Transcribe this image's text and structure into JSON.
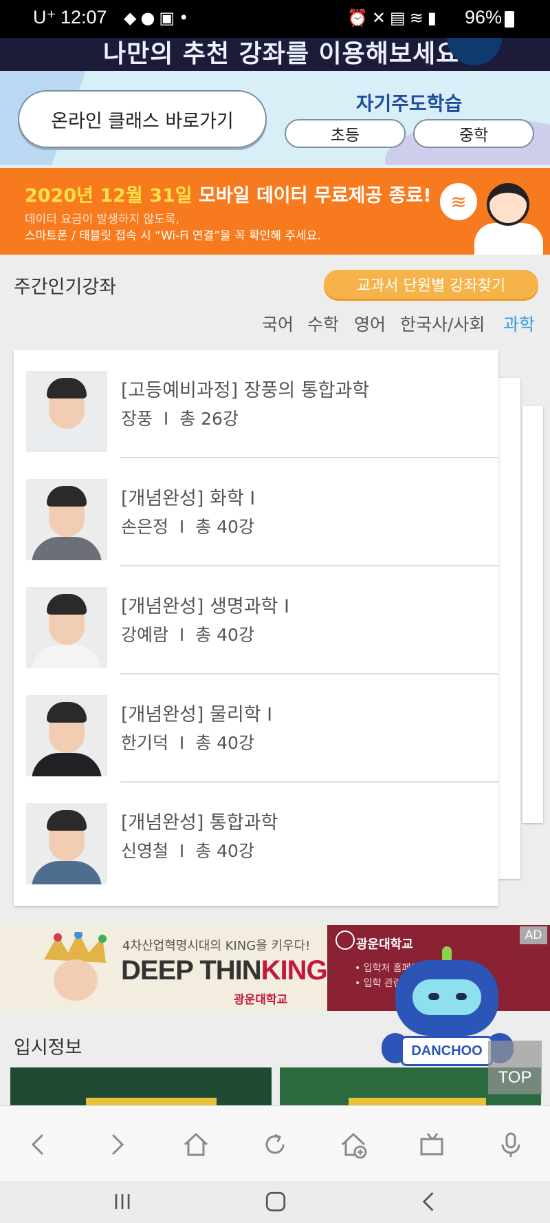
{
  "status_bar": {
    "carrier": "U⁺",
    "time": "12:07",
    "battery": "96%",
    "left_icons": [
      "pill-icon",
      "talk-icon",
      "image-icon",
      "dot-icon"
    ],
    "right_icons": [
      "alarm-icon",
      "mute-icon",
      "save-icon",
      "wifi-icon",
      "signal-icon"
    ]
  },
  "top_banner": {
    "text": "나만의 추천 강좌를 이용해보세요."
  },
  "class_nav": {
    "online_label": "온라인 클래스 바로가기",
    "self_study_title": "자기주도학습",
    "elementary_label": "초등",
    "middle_label": "중학"
  },
  "notice": {
    "date_text": "2020년 12월 31일",
    "title_rest": " 모바일 데이터 무료제공 종료!",
    "line2": "데이터 요금이 발생하지 않도록,",
    "line3": "스마트폰 / 태블릿 접속 시 “Wi-Fi 연결”을 꼭 확인해 주세요."
  },
  "weekly": {
    "title": "주간인기강좌",
    "find_button": "교과서 단원별 강좌찾기",
    "tabs": [
      "국어",
      "수학",
      "영어",
      "한국사/사회",
      "과학"
    ],
    "active_tab": "과학",
    "courses": [
      {
        "title": "[고등예비과정] 장풍의 통합과학",
        "instructor": "장풍",
        "sep": "I",
        "count": "총 26강"
      },
      {
        "title": "[개념완성] 화학 I",
        "instructor": "손은정",
        "sep": "I",
        "count": "총 40강"
      },
      {
        "title": "[개념완성] 생명과학 I",
        "instructor": "강예람",
        "sep": "I",
        "count": "총 40강"
      },
      {
        "title": "[개념완성] 물리학 I",
        "instructor": "한기덕",
        "sep": "I",
        "count": "총 40강"
      },
      {
        "title": "[개념완성] 통합과학",
        "instructor": "신영철",
        "sep": "I",
        "count": "총 40강"
      }
    ]
  },
  "ad": {
    "subtitle": "4차산업혁명시대의 KING을 키우다!",
    "headline_a": "DEEP THIN",
    "headline_b": "KING",
    "brand": "광운대학교",
    "right_title": "광운대학교",
    "right_lines": [
      "• 입학처 홈페이지",
      "• 입학 관련 문의"
    ],
    "tag": "AD"
  },
  "admissions": {
    "title": "입시정보"
  },
  "mascot": {
    "label": "DANCHOO"
  },
  "top_button": "TOP",
  "colors": {
    "accent_blue": "#2e9fd8",
    "orange": "#f77a1e",
    "button_orange": "#f6b34a"
  }
}
